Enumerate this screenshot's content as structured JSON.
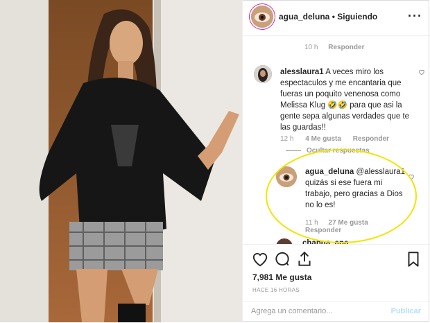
{
  "post": {
    "username": "agua_deluna",
    "separator": "•",
    "follow_status": "Siguiendo",
    "more_icon": "more-options-icon"
  },
  "comments": {
    "top_time": "10 h",
    "top_reply": "Responder",
    "comment1": {
      "username": "alesslaura1",
      "text": "A veces miro los espectaculos y me encantaria que fueras un poquito venenosa como Melissa Klug 🤣🤣 para que asi la gente sepa algunas verdades que te las guardas!!",
      "time": "12 h",
      "likes": "4 Me gusta",
      "reply": "Responder"
    },
    "hide_replies": "Ocultar respuestas",
    "reply1": {
      "username": "agua_deluna",
      "mention": "@alesslaura1",
      "text": "quizás si ese fuera mi trabajo, pero gracias a Dios no lo es!",
      "time": "11 h",
      "likes": "27 Me gusta",
      "reply": "Responder"
    },
    "comment2": {
      "username": "changa_ana"
    }
  },
  "actions": {
    "like_icon": "heart-icon",
    "comment_icon": "comment-icon",
    "share_icon": "share-icon",
    "save_icon": "bookmark-icon"
  },
  "likes_count": "7,981 Me gusta",
  "timestamp": "HACE 16 HORAS",
  "add_comment": {
    "placeholder": "Agrega un comentario...",
    "publish_label": "Publicar"
  },
  "colors": {
    "highlight": "#f2e400",
    "publish": "#b2dffc",
    "meta_text": "#999999"
  }
}
